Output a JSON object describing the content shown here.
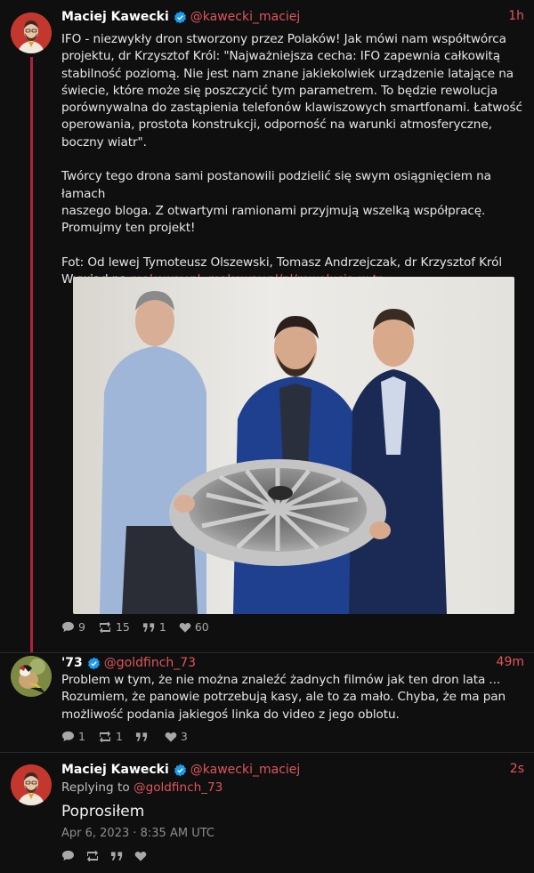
{
  "colors": {
    "accent": "#e0555b",
    "thread": "#b0203a",
    "background": "#0f0f0f",
    "verified": "#1d9bf0"
  },
  "post1": {
    "author_name": "Maciej Kawecki",
    "handle": "@kawecki_maciej",
    "time": "1h",
    "body": "IFO - niezwykły dron stworzony przez Polaków! Jak mówi nam współtwórca\nprojektu, dr Krzysztof Król: \"Najważniejsza cecha: IFO zapewnia całkowitą\nstabilność poziomą. Nie jest nam znane jakiekolwiek urządzenie latające na\nświecie, które może się poszczycić tym parametrem. To będzie rewolucja\nporównywalna do zastąpienia telefonów klawiszowych smartfonami. Łatwość\noperowania, prostota konstrukcji, odporność na warunki atmosferyczne,\nboczny wiatr\".\n\nTwórcy tego drona sami postanowili podzielić się swym osiągnięciem na łamach\nnaszego bloga. Z otwartymi ramionami przyjmują wszelką współpracę.\nPromujmy ten projekt!\n\nFot: Od lewej Tymoteusz Olszewski, Tomasz Andrzejczak, dr Krzysztof Król\n",
    "interview_prefix": "Wywiad na ",
    "interview_site": "makeway.pl",
    "interview_sep": ": ",
    "interview_link": "makeway.pl/pl/rewolucja-w-tr…",
    "replies": "9",
    "reposts": "15",
    "quotes": "1",
    "likes": "60"
  },
  "post2": {
    "author_name": "'73",
    "handle": "@goldfinch_73",
    "time": "49m",
    "body": "Problem w tym, że nie można znaleźć żadnych filmów jak ten dron lata ...\nRozumiem, że panowie potrzebują kasy, ale to za mało. Chyba, że ma pan\nmożliwość podania jakiegoś linka do video z jego oblotu.",
    "replies": "1",
    "reposts": "1",
    "quotes": "",
    "likes": "3"
  },
  "post3": {
    "author_name": "Maciej Kawecki",
    "handle": "@kawecki_maciej",
    "time": "2s",
    "replying_prefix": "Replying to ",
    "replying_handle": "@goldfinch_73",
    "body": "Poprosiłem",
    "date": "Apr 6, 2023 · 8:35 AM UTC"
  },
  "icons": [
    "verified-icon",
    "reply-icon",
    "repost-icon",
    "quote-icon",
    "like-icon"
  ]
}
